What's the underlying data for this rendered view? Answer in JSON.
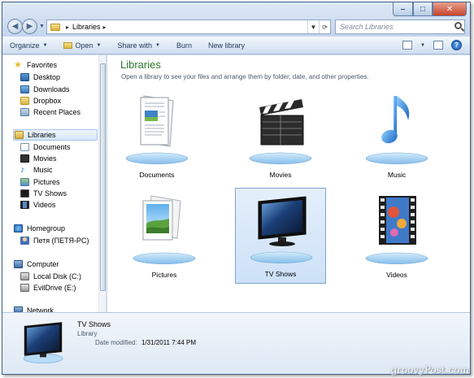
{
  "address": {
    "path": "Libraries"
  },
  "search": {
    "placeholder": "Search Libraries"
  },
  "toolbar": {
    "organize": "Organize",
    "open": "Open",
    "share_with": "Share with",
    "burn": "Burn",
    "new_library": "New library"
  },
  "nav": {
    "favorites": "Favorites",
    "desktop": "Desktop",
    "downloads": "Downloads",
    "dropbox": "Dropbox",
    "recent_places": "Recent Places",
    "libraries": "Libraries",
    "documents": "Documents",
    "movies": "Movies",
    "music": "Music",
    "pictures": "Pictures",
    "tv_shows": "TV Shows",
    "videos": "Videos",
    "homegroup": "Homegroup",
    "user": "Петя (ПЕТЯ-PC)",
    "computer": "Computer",
    "local_disk": "Local Disk (C:)",
    "evildrive": "EvilDrive (E:)",
    "network": "Network"
  },
  "content": {
    "title": "Libraries",
    "description": "Open a library to see your files and arrange them by folder, date, and other properties.",
    "libraries": [
      "Documents",
      "Movies",
      "Music",
      "Pictures",
      "TV Shows",
      "Videos"
    ],
    "selected": "TV Shows"
  },
  "details": {
    "name": "TV Shows",
    "type": "Library",
    "date_label": "Date modified:",
    "date_value": "1/31/2011 7:44 PM"
  },
  "watermark": "groovyPost.com",
  "colors": {
    "title_green": "#267a29",
    "selection": "#cde1f7",
    "frame": "#c8d9ef"
  }
}
